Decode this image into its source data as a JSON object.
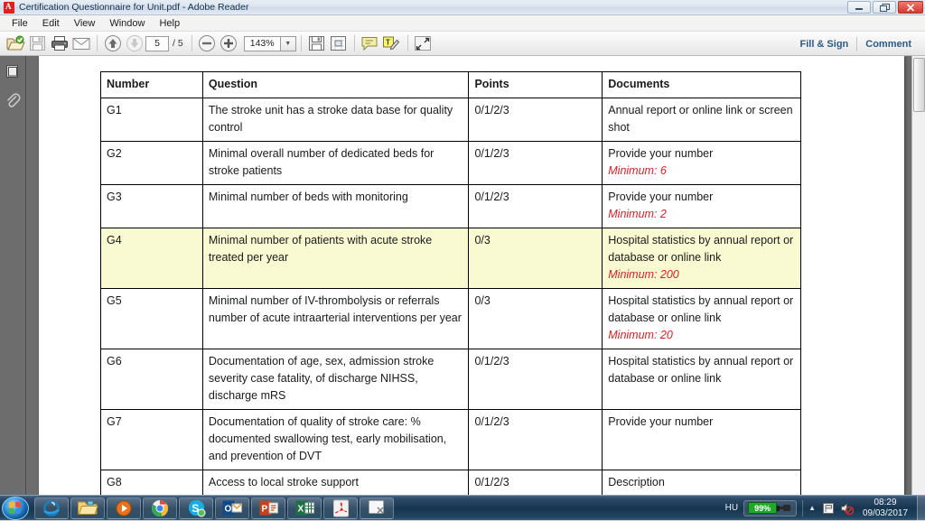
{
  "window": {
    "title": "Certification Questionnaire for Unit.pdf - Adobe Reader",
    "app_icon": "pdf-icon",
    "buttons": {
      "minimize": "—",
      "restore": "❐",
      "close": "✕"
    }
  },
  "menubar": {
    "items": [
      "File",
      "Edit",
      "View",
      "Window",
      "Help"
    ]
  },
  "toolbar": {
    "open_label": "open-file",
    "save_label": "save-file",
    "print_label": "print",
    "email_label": "email",
    "prev_page_label": "previous-page",
    "next_page_label": "next-page",
    "page_current": "5",
    "page_total": "/ 5",
    "zoom_out_label": "zoom-out",
    "zoom_in_label": "zoom-in",
    "zoom_value": "143%",
    "zoom_caret": "▼",
    "save_copy_label": "save-a-copy",
    "snapshot_label": "snapshot",
    "comment_tool_label": "sticky-note",
    "highlight_tool_label": "highlight-text",
    "fullscreen_label": "read-mode",
    "fill_and_sign": "Fill & Sign",
    "comment": "Comment"
  },
  "navpane": {
    "page_thumbnails_label": "page-thumbnails",
    "attachments_label": "attachments"
  },
  "document": {
    "table": {
      "headers": [
        "Number",
        "Question",
        "Points",
        "Documents"
      ],
      "rows": [
        {
          "number": "G1",
          "question": "The stroke unit has a stroke data base for quality control",
          "points": "0/1/2/3",
          "documents": "Annual report or online link or screen shot",
          "minimum": "",
          "highlighted": false
        },
        {
          "number": "G2",
          "question": "Minimal overall number of dedicated beds for stroke patients",
          "points": "0/1/2/3",
          "documents": "Provide your number",
          "minimum": "Minimum: 6",
          "highlighted": false
        },
        {
          "number": "G3",
          "question": "Minimal number of beds with monitoring",
          "points": "0/1/2/3",
          "documents": "Provide your number",
          "minimum": "Minimum: 2",
          "highlighted": false
        },
        {
          "number": "G4",
          "question": "Minimal number of patients with acute stroke treated per year",
          "points": "0/3",
          "documents": "Hospital statistics by annual report or database or online link",
          "minimum": "Minimum: 200",
          "highlighted": true
        },
        {
          "number": "G5",
          "question": "Minimal number of IV-thrombolysis or referrals number of acute intraarterial interventions per year",
          "points": "0/3",
          "documents": "Hospital statistics by annual report or database or online link",
          "minimum": "Minimum: 20",
          "highlighted": false
        },
        {
          "number": "G6",
          "question": "Documentation of age, sex, admission stroke severity case fatality, of discharge NIHSS, discharge mRS",
          "points": "0/1/2/3",
          "documents": "Hospital statistics by annual report or database or online link",
          "minimum": "",
          "highlighted": false
        },
        {
          "number": "G7",
          "question": "Documentation of quality of stroke care: % documented swallowing test, early mobilisation, and prevention of DVT",
          "points": "0/1/2/3",
          "documents": "Provide your number",
          "minimum": "",
          "highlighted": false
        },
        {
          "number": "G8",
          "question": "Access to local stroke support",
          "points": "0/1/2/3",
          "documents": "Description",
          "minimum": "",
          "highlighted": false
        }
      ]
    }
  },
  "taskbar": {
    "start_label": "start-orb",
    "apps": [
      {
        "name": "internet-explorer-icon"
      },
      {
        "name": "file-explorer-icon"
      },
      {
        "name": "media-player-icon"
      },
      {
        "name": "google-chrome-icon"
      },
      {
        "name": "skype-icon"
      },
      {
        "name": "outlook-icon"
      },
      {
        "name": "powerpoint-icon"
      },
      {
        "name": "excel-icon"
      },
      {
        "name": "adobe-reader-icon"
      },
      {
        "name": "snipping-tool-icon"
      }
    ],
    "tray": {
      "language": "HU",
      "battery_percent": "99%",
      "show_hidden_caret": "▲",
      "action_center_icon": "flag-icon",
      "volume_icon": "speaker-muted-icon",
      "time": "08:29",
      "date": "09/03/2017"
    }
  },
  "colors": {
    "highlight_yellow": "#fafad2",
    "minimum_red": "#d81f26",
    "link_blue": "#2b5a86",
    "battery_green": "#1fa82c"
  }
}
